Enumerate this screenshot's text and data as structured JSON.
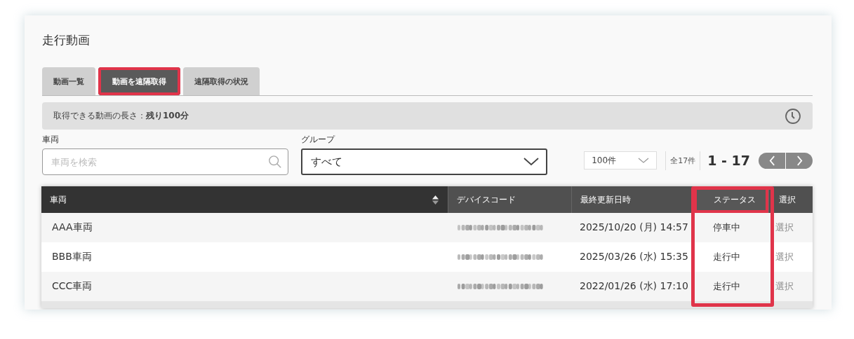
{
  "page_title": "走行動画",
  "tabs": [
    {
      "label": "動画一覧",
      "selected": false,
      "highlighted": false
    },
    {
      "label": "動画を遠隔取得",
      "selected": true,
      "highlighted": true
    },
    {
      "label": "遠隔取得の状況",
      "selected": false,
      "highlighted": false
    }
  ],
  "info_bar": {
    "text": "取得できる動画の長さ：**残り100分**"
  },
  "vehicle_filter": {
    "label": "車両",
    "placeholder": "車両を検索"
  },
  "group_filter": {
    "label": "グループ",
    "value": "すべて"
  },
  "pagination": {
    "per_page": "100件",
    "total": "全17件",
    "range": "1 - 17"
  },
  "table": {
    "columns": [
      {
        "label": "車両",
        "sortable": true,
        "highlighted": false
      },
      {
        "label": "デバイスコード",
        "sortable": false,
        "highlighted": false
      },
      {
        "label": "最終更新日時",
        "sortable": false,
        "highlighted": false
      },
      {
        "label": "ステータス",
        "sortable": false,
        "highlighted": true
      },
      {
        "label": "選択",
        "sortable": false,
        "highlighted": false
      }
    ],
    "rows": [
      {
        "vehicle": "AAA車両",
        "updated": "2025/10/20 (月) 14:57",
        "status": "停車中",
        "action": "選択"
      },
      {
        "vehicle": "BBB車両",
        "updated": "2025/03/26 (水) 15:35",
        "status": "走行中",
        "action": "選択"
      },
      {
        "vehicle": "CCC車両",
        "updated": "2022/01/26 (水) 17:10",
        "status": "走行中",
        "action": "選択"
      }
    ]
  }
}
